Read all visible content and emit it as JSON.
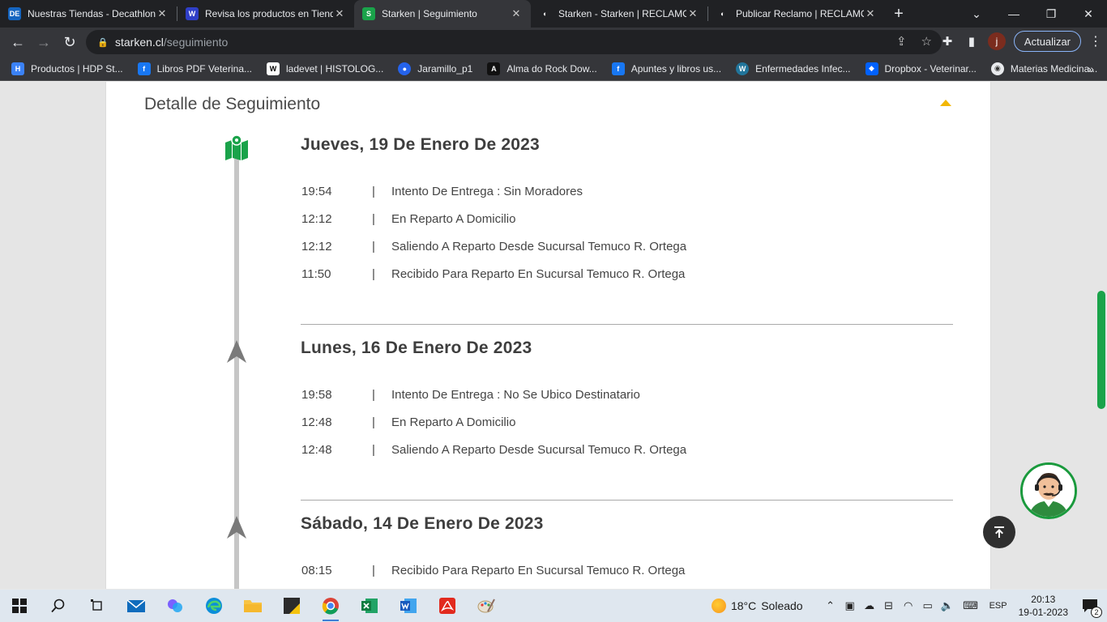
{
  "tabs": [
    {
      "title": "Nuestras Tiendas - Decathlon",
      "favicon": "DE",
      "favicon_color": "#1565c0",
      "active": false
    },
    {
      "title": "Revisa los productos en Tiendas",
      "favicon": "W",
      "favicon_color": "#2f3fc7",
      "active": false
    },
    {
      "title": "Starken | Seguimiento",
      "favicon": "S",
      "favicon_color": "#1aa34a",
      "active": true
    },
    {
      "title": "Starken - Starken | RECLAMOS",
      "favicon": "◐",
      "favicon_color": "#202124",
      "active": false
    },
    {
      "title": "Publicar Reclamo | RECLAMOS",
      "favicon": "◐",
      "favicon_color": "#202124",
      "active": false
    }
  ],
  "address": {
    "host": "starken.cl",
    "path": "/seguimiento"
  },
  "toolbar": {
    "update_label": "Actualizar",
    "profile_initial": "j"
  },
  "bookmarks": [
    {
      "label": "Productos | HDP St...",
      "icon_color": "#3b82f6",
      "glyph": "H"
    },
    {
      "label": "Libros PDF Veterina...",
      "icon_color": "#1877f2",
      "glyph": "f"
    },
    {
      "label": "ladevet | HISTOLOG...",
      "icon_color": "#ffffff",
      "glyph": "W"
    },
    {
      "label": "Jaramillo_p1",
      "icon_color": "#2563eb",
      "glyph": "●"
    },
    {
      "label": "Alma do Rock Dow...",
      "icon_color": "#111111",
      "glyph": "A"
    },
    {
      "label": "Apuntes y libros us...",
      "icon_color": "#1877f2",
      "glyph": "f"
    },
    {
      "label": "Enfermedades Infec...",
      "icon_color": "#21759b",
      "glyph": "W"
    },
    {
      "label": "Dropbox - Veterinar...",
      "icon_color": "#0061fe",
      "glyph": "◆"
    },
    {
      "label": "Materias Medicina...",
      "icon_color": "#e8eaed",
      "glyph": "◉"
    }
  ],
  "page": {
    "section_title": "Detalle de Seguimiento",
    "days": [
      {
        "title": "Jueves, 19 De Enero De 2023",
        "events": [
          {
            "time": "19:54",
            "desc": "Intento De Entrega : Sin Moradores"
          },
          {
            "time": "12:12",
            "desc": "En Reparto A Domicilio"
          },
          {
            "time": "12:12",
            "desc": "Saliendo A Reparto Desde Sucursal Temuco R. Ortega"
          },
          {
            "time": "11:50",
            "desc": "Recibido Para Reparto En Sucursal Temuco R. Ortega"
          }
        ]
      },
      {
        "title": "Lunes, 16 De Enero De 2023",
        "events": [
          {
            "time": "19:58",
            "desc": "Intento De Entrega : No Se Ubico Destinatario"
          },
          {
            "time": "12:48",
            "desc": "En Reparto A Domicilio"
          },
          {
            "time": "12:48",
            "desc": "Saliendo A Reparto Desde Sucursal Temuco R. Ortega"
          }
        ]
      },
      {
        "title": "Sábado, 14 De Enero De 2023",
        "events": [
          {
            "time": "08:15",
            "desc": "Recibido Para Reparto En Sucursal Temuco R. Ortega"
          }
        ]
      }
    ],
    "separator": "|"
  },
  "taskbar": {
    "weather_temp": "18°C",
    "weather_text": "Soleado",
    "language": "ESP",
    "time": "20:13",
    "date": "19-01-2023",
    "notification_count": "2"
  },
  "colors": {
    "brand_green": "#1aa34a",
    "accent_yellow": "#f2b705"
  }
}
